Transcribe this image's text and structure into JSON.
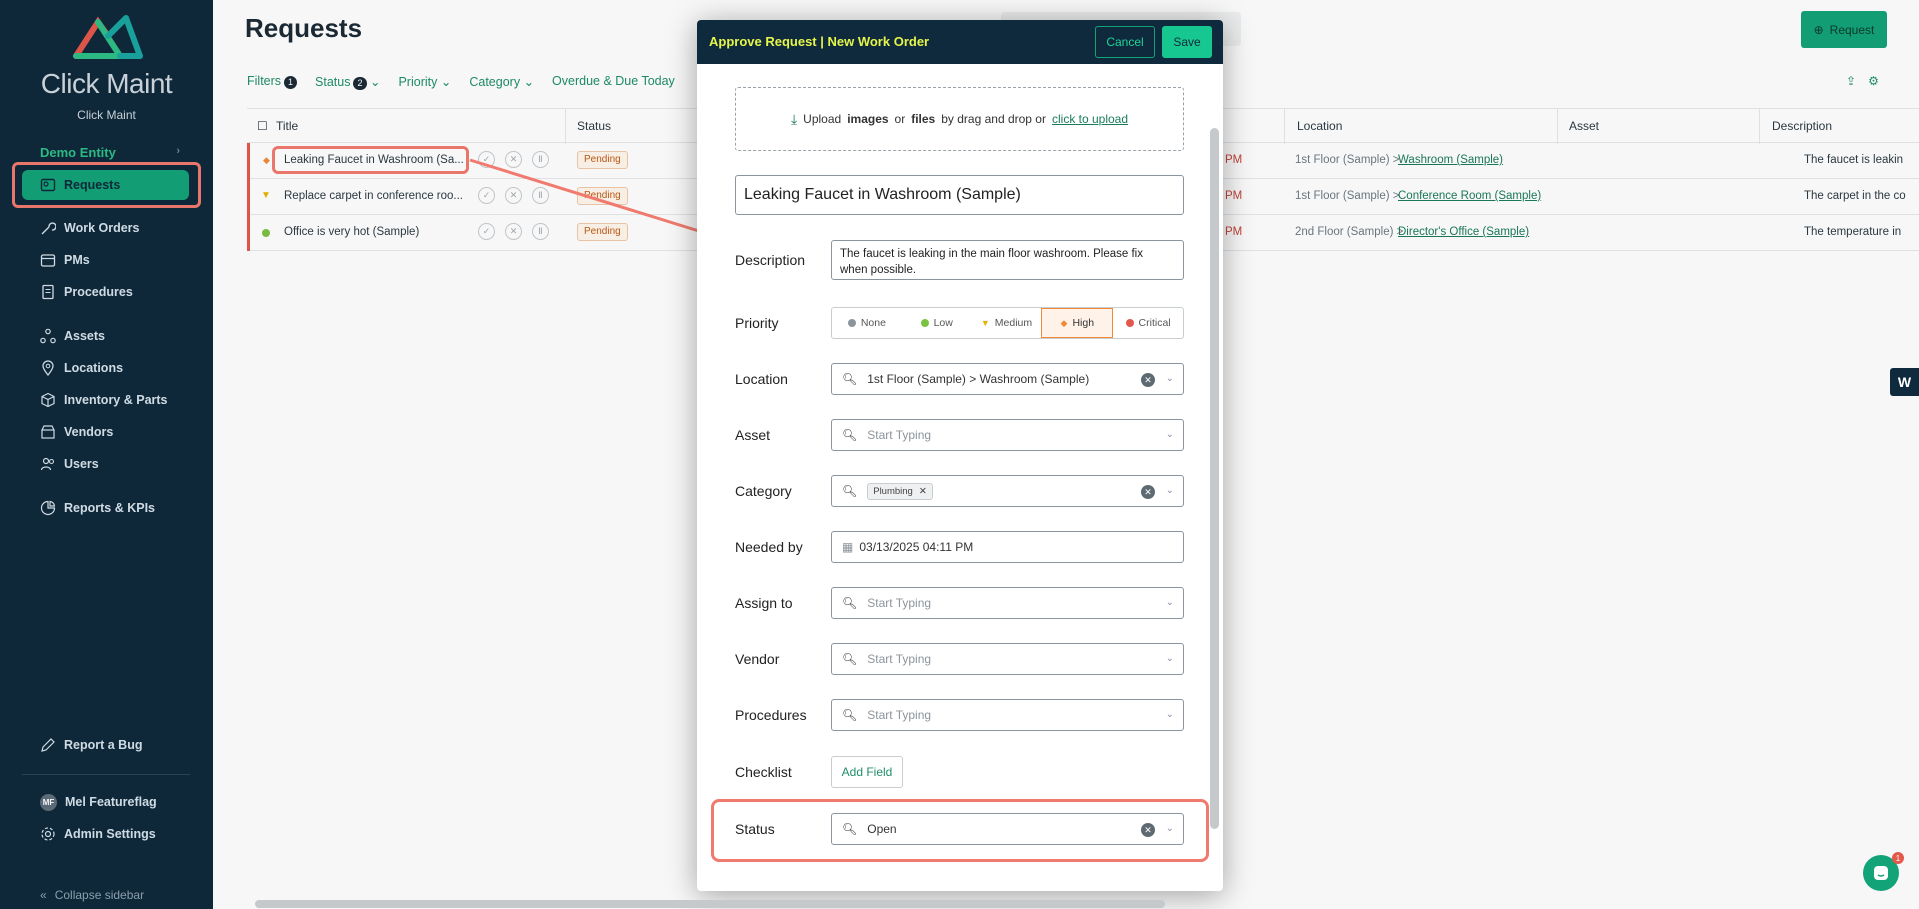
{
  "sidebar": {
    "brand": "Click Maint",
    "brand_sub": "Click Maint",
    "entity": "Demo Entity",
    "nav": [
      {
        "label": "Requests",
        "icon": "requests-icon",
        "active": true
      },
      {
        "label": "Work Orders",
        "icon": "wrench-icon"
      },
      {
        "label": "PMs",
        "icon": "calendar-icon"
      },
      {
        "label": "Procedures",
        "icon": "document-icon"
      },
      {
        "label": "Assets",
        "icon": "assets-icon"
      },
      {
        "label": "Locations",
        "icon": "location-pin-icon"
      },
      {
        "label": "Inventory & Parts",
        "icon": "box-icon"
      },
      {
        "label": "Vendors",
        "icon": "vendor-icon"
      },
      {
        "label": "Users",
        "icon": "users-icon"
      },
      {
        "label": "Reports & KPIs",
        "icon": "reports-icon"
      }
    ],
    "report_bug": "Report a Bug",
    "user_initials": "MF",
    "user_name": "Mel Featureflag",
    "admin_settings": "Admin Settings",
    "collapse": "Collapse sidebar"
  },
  "main": {
    "title": "Requests",
    "new_request": "Request",
    "filters": [
      {
        "label": "Filters",
        "badge": "1"
      },
      {
        "label": "Status",
        "badge": "2"
      },
      {
        "label": "Priority"
      },
      {
        "label": "Category"
      },
      {
        "label": "Overdue & Due Today"
      }
    ],
    "columns": [
      "Title",
      "Status",
      "Location",
      "Asset",
      "Description"
    ],
    "rows": [
      {
        "title": "Leaking Faucet in Washroom (Sa...",
        "status": "Pending",
        "pm": "PM",
        "loc_prefix": "1st Floor (Sample) >",
        "loc_link": "Washroom (Sample)",
        "desc": "The faucet is leakin",
        "prio_color": "#f08a3a"
      },
      {
        "title": "Replace carpet in conference roo...",
        "status": "Pending",
        "pm": "PM",
        "loc_prefix": "1st Floor (Sample) >",
        "loc_link": "Conference Room (Sample)",
        "desc": "The carpet in the co",
        "prio_color": "#e5b400"
      },
      {
        "title": "Office is very hot (Sample)",
        "status": "Pending",
        "pm": "PM",
        "loc_prefix": "2nd Floor (Sample) >",
        "loc_link": "Director's Office (Sample)",
        "desc": "The temperature in",
        "prio_color": "#7cc242"
      }
    ]
  },
  "modal": {
    "title": "Approve Request | New Work Order",
    "cancel": "Cancel",
    "save": "Save",
    "upload_pre": "Upload",
    "upload_images": "images",
    "upload_or": "or",
    "upload_files": "files",
    "upload_mid": "by drag and drop or",
    "upload_link": "click to upload",
    "request_title": "Leaking Faucet in Washroom (Sample)",
    "labels": {
      "description": "Description",
      "priority": "Priority",
      "location": "Location",
      "asset": "Asset",
      "category": "Category",
      "needed_by": "Needed by",
      "assign_to": "Assign to",
      "vendor": "Vendor",
      "procedures": "Procedures",
      "checklist": "Checklist",
      "status": "Status"
    },
    "description": "The faucet is leaking in the main floor washroom. Please fix when possible.",
    "priority_options": [
      {
        "label": "None",
        "color": "#8c959b"
      },
      {
        "label": "Low",
        "color": "#7cc242"
      },
      {
        "label": "Medium",
        "color": "#e5b400"
      },
      {
        "label": "High",
        "color": "#f08a3a",
        "selected": true
      },
      {
        "label": "Critical",
        "color": "#e4584b"
      }
    ],
    "location": "1st Floor (Sample) > Washroom (Sample)",
    "placeholder": "Start Typing",
    "category_chip": "Plumbing",
    "needed_by": "03/13/2025 04:11 PM",
    "add_field": "Add Field",
    "status": "Open"
  }
}
